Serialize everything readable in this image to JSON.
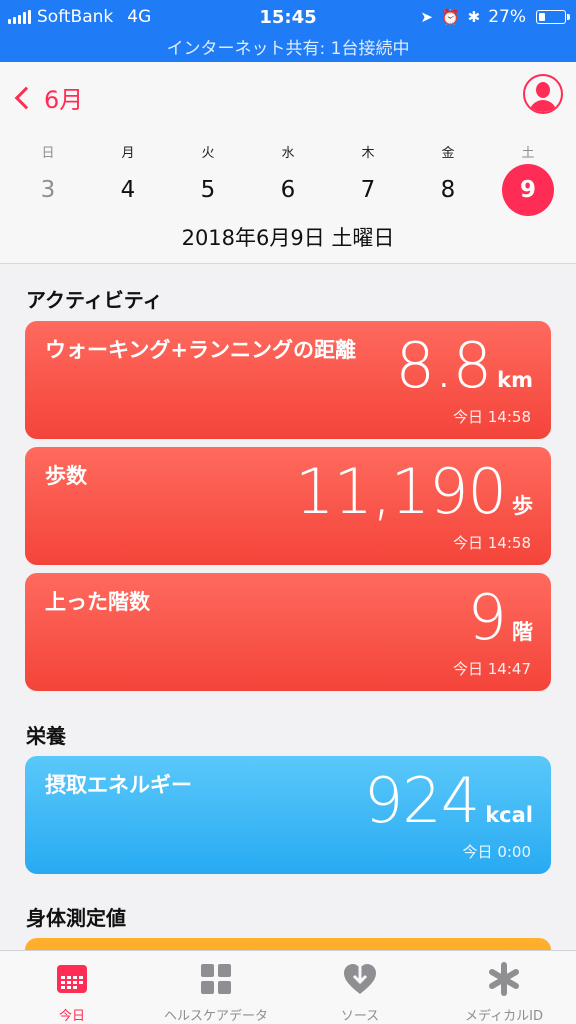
{
  "status_bar": {
    "carrier": "SoftBank",
    "network": "4G",
    "time": "15:45",
    "battery": "27%",
    "battery_level": 0.27,
    "hotspot_text": "インターネット共有: 1台接続中"
  },
  "header": {
    "back_label": "6月",
    "weekdays": [
      "日",
      "月",
      "火",
      "水",
      "木",
      "金",
      "土"
    ],
    "days": [
      "3",
      "4",
      "5",
      "6",
      "7",
      "8",
      "9"
    ],
    "selected_day": "9",
    "full_date": "2018年6月9日 土曜日"
  },
  "sections": {
    "activity": "アクティビティ",
    "nutrition": "栄養",
    "body": "身体測定値"
  },
  "cards": {
    "distance": {
      "label": "ウォーキング+ランニングの距離",
      "value": "8.8",
      "unit": "km",
      "time": "今日 14:58"
    },
    "steps": {
      "label": "歩数",
      "value": "11,190",
      "unit": "歩",
      "time": "今日 14:58"
    },
    "floors": {
      "label": "上った階数",
      "value": "9",
      "unit": "階",
      "time": "今日 14:47"
    },
    "energy": {
      "label": "摂取エネルギー",
      "value": "924",
      "unit": "kcal",
      "time": "今日 0:00"
    }
  },
  "tabs": {
    "today": "今日",
    "health_data": "ヘルスケアデータ",
    "sources": "ソース",
    "medical_id": "メディカルID"
  },
  "colors": {
    "accent": "#ff2d55",
    "status_bar": "#1f7cf6",
    "activity_card": "#f4443a",
    "nutrition_card": "#28aaf2",
    "body_card": "#ff9500"
  }
}
